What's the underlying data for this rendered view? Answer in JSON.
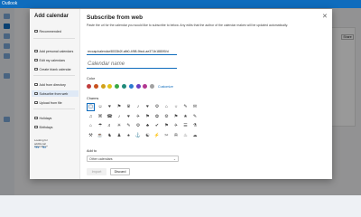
{
  "app": {
    "brand": "Outlook",
    "brand_color": "#0f6cbd"
  },
  "background": {
    "button_label": "Share"
  },
  "sidebar": {
    "title": "Add calendar",
    "items": [
      {
        "label": "Recommended",
        "icon": "sparkle-icon"
      },
      {
        "label": "Add personal calendars",
        "icon": "calendar-icon"
      },
      {
        "label": "Edit my calendars",
        "icon": "pencil-icon"
      },
      {
        "label": "Create blank calendar",
        "icon": "calendar-add-icon"
      },
      {
        "label": "Add from directory",
        "icon": "people-icon"
      },
      {
        "label": "Subscribe from web",
        "icon": "globe-icon",
        "active": true
      },
      {
        "label": "Upload from file",
        "icon": "upload-icon"
      },
      {
        "label": "Holidays",
        "icon": "gift-icon"
      },
      {
        "label": "Birthdays",
        "icon": "cake-icon"
      }
    ],
    "feedback": {
      "text": "Looking for additional calendars?",
      "yes": "Yes",
      "no": "No"
    }
  },
  "dialog": {
    "title": "Subscribe from web",
    "description": "Paste the url for the calendar you would like to subscribe to below. Any edits that the author of the calendar makes will be updated automatically.",
    "url_value": "reccap/calendar/8033b2f-afb0-4f98-9bcd-ae371b1880f0/d",
    "name_placeholder": "Calendar name",
    "color_label": "Color",
    "colors": [
      "#c13d3d",
      "#c9521f",
      "#d1a11a",
      "#e0c21a",
      "#3aa845",
      "#1f8a7a",
      "#2b7bd0",
      "#6a3fc4",
      "#b3368f",
      "#a0a0a0"
    ],
    "customize_label": "Customize",
    "charms_label": "Charms",
    "charms": [
      [
        "▢",
        "☺",
        "♥",
        "⚑",
        "♛",
        "♪",
        "♥",
        "⚙",
        "⌂",
        "☼",
        "✎",
        "✉"
      ],
      [
        "♫",
        "⌘",
        "☎",
        "♪",
        "♥",
        "✈",
        "⚑",
        "✿",
        "⚙",
        "⚑",
        "★",
        "✎"
      ],
      [
        "⌂",
        "☂",
        "♬",
        "☀",
        "✎",
        "⚙",
        "♣",
        "✔",
        "⚑",
        "✈",
        "☰",
        "⚗"
      ],
      [
        "⚒",
        "☕",
        "♞",
        "♟",
        "♠",
        "⚓",
        "☯",
        "⚡",
        "✂",
        "✇",
        "♨",
        "☁"
      ]
    ],
    "add_to_label": "Add to",
    "add_to_value": "Other calendars",
    "import_label": "Import",
    "discard_label": "Discard",
    "close_icon": "close-icon"
  }
}
